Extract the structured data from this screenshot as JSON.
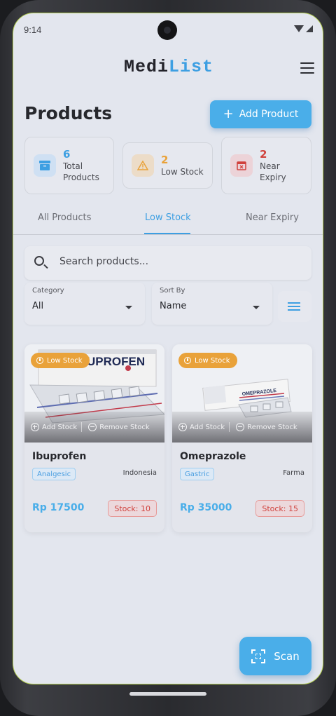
{
  "status_bar": {
    "time": "9:14"
  },
  "app": {
    "logo_part1": "Medi",
    "logo_part2": "List"
  },
  "page": {
    "title": "Products",
    "add_button": "Add Product"
  },
  "stats": [
    {
      "value": "6",
      "label": "Total Products",
      "color": "#3d9fe2"
    },
    {
      "value": "2",
      "label": "Low Stock",
      "color": "#e9a23a"
    },
    {
      "value": "2",
      "label": "Near Expiry",
      "color": "#d0413c"
    }
  ],
  "tabs": [
    {
      "label": "All Products",
      "active": false
    },
    {
      "label": "Low Stock",
      "active": true
    },
    {
      "label": "Near Expiry",
      "active": false
    }
  ],
  "search": {
    "placeholder": "Search products..."
  },
  "filters": {
    "category": {
      "label": "Category",
      "value": "All"
    },
    "sort": {
      "label": "Sort By",
      "value": "Name"
    }
  },
  "products": [
    {
      "badge": "Low Stock",
      "add_stock": "Add Stock",
      "remove_stock": "Remove Stock",
      "name": "Ibuprofen",
      "category": "Analgesic",
      "origin": "Indonesia",
      "price": "Rp 17500",
      "stock": "Stock: 10",
      "box_text": "IBUPROFEN"
    },
    {
      "badge": "Low Stock",
      "add_stock": "Add Stock",
      "remove_stock": "Remove Stock",
      "name": "Omeprazole",
      "category": "Gastric",
      "origin": "Farma",
      "price": "Rp 35000",
      "stock": "Stock: 15",
      "box_text": "OMEPRAZOLE"
    }
  ],
  "scan_button": "Scan",
  "colors": {
    "accent": "#4aaee9",
    "warning": "#e9a23a",
    "danger": "#d0413c"
  }
}
